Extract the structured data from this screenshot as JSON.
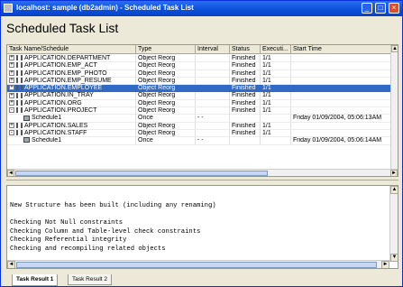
{
  "window": {
    "title": "localhost: sample (db2admin) - Scheduled Task List"
  },
  "page": {
    "heading": "Scheduled Task List"
  },
  "grid": {
    "columns": [
      "Task Name/Schedule",
      "Type",
      "Interval",
      "Status",
      "Executi...",
      "Start Time"
    ],
    "rows": [
      {
        "name": "APPLICATION.DEPARTMENT",
        "type": "Object Reorg",
        "interval": "",
        "status": "Finished",
        "exec": "1/1",
        "start": "",
        "kind": "task",
        "expander": "+"
      },
      {
        "name": "APPLICATION.EMP_ACT",
        "type": "Object Reorg",
        "interval": "",
        "status": "Finished",
        "exec": "1/1",
        "start": "",
        "kind": "task",
        "expander": "+"
      },
      {
        "name": "APPLICATION.EMP_PHOTO",
        "type": "Object Reorg",
        "interval": "",
        "status": "Finished",
        "exec": "1/1",
        "start": "",
        "kind": "task",
        "expander": "+"
      },
      {
        "name": "APPLICATION.EMP_RESUME",
        "type": "Object Reorg",
        "interval": "",
        "status": "Finished",
        "exec": "1/1",
        "start": "",
        "kind": "task",
        "expander": "+"
      },
      {
        "name": "APPLICATION.EMPLOYEE",
        "type": "Object Reorg",
        "interval": "",
        "status": "Finished",
        "exec": "1/1",
        "start": "",
        "kind": "task",
        "expander": "+",
        "selected": true
      },
      {
        "name": "APPLICATION.IN_TRAY",
        "type": "Object Reorg",
        "interval": "",
        "status": "Finished",
        "exec": "1/1",
        "start": "",
        "kind": "task",
        "expander": "+"
      },
      {
        "name": "APPLICATION.ORG",
        "type": "Object Reorg",
        "interval": "",
        "status": "Finished",
        "exec": "1/1",
        "start": "",
        "kind": "task",
        "expander": "+"
      },
      {
        "name": "APPLICATION.PROJECT",
        "type": "Object Reorg",
        "interval": "",
        "status": "Finished",
        "exec": "1/1",
        "start": "",
        "kind": "task",
        "expander": "-"
      },
      {
        "name": "Schedule1",
        "type": "Once",
        "interval": "- -",
        "status": "",
        "exec": "",
        "start": "Friday 01/09/2004, 05:06:13AM",
        "kind": "schedule",
        "expander": ""
      },
      {
        "name": "APPLICATION.SALES",
        "type": "Object Reorg",
        "interval": "",
        "status": "Finished",
        "exec": "1/1",
        "start": "",
        "kind": "task",
        "expander": "+"
      },
      {
        "name": "APPLICATION.STAFF",
        "type": "Object Reorg",
        "interval": "",
        "status": "Finished",
        "exec": "1/1",
        "start": "",
        "kind": "task",
        "expander": "-"
      },
      {
        "name": "Schedule1",
        "type": "Once",
        "interval": "- -",
        "status": "",
        "exec": "",
        "start": "Friday 01/09/2004, 05:06:14AM",
        "kind": "schedule",
        "expander": ""
      }
    ]
  },
  "output": {
    "lines": [
      "New Structure has been built (including any renaming)",
      "",
      "Checking Not Null constraints",
      "Checking Column and Table-level check constraints",
      "Checking Referential integrity",
      "Checking and recompiling related objects"
    ]
  },
  "tabs": [
    {
      "label": "Task Result 1",
      "active": true
    },
    {
      "label": "Task Result 2",
      "active": false
    }
  ],
  "colors": {
    "selection": "#316ac5",
    "titlebar": "#0a4fd9"
  }
}
